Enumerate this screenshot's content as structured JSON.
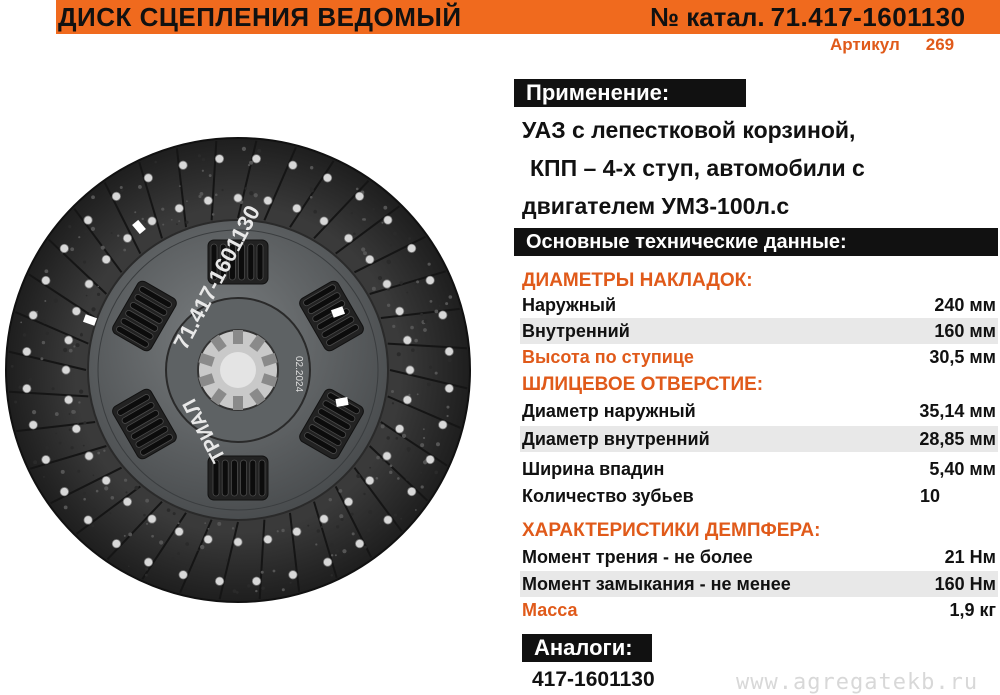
{
  "header": {
    "title": "ДИСК СЦЕПЛЕНИЯ ВЕДОМЫЙ",
    "catalog_label": "№ катал.",
    "catalog_number": "71.417-1601130",
    "article_label": "Артикул",
    "article_value": "269"
  },
  "disc_image": {
    "marking": "71.417-1601130",
    "brand": "ТРИАЛ",
    "small_code": "02.2024"
  },
  "application": {
    "heading": "Применение:",
    "lines": [
      "УАЗ с лепестковой корзиной,",
      "КПП – 4-х ступ, автомобили с",
      "двигателем УМЗ-100л.с"
    ]
  },
  "specs": {
    "heading": "Основные технические данные:",
    "linings_title": "ДИАМЕТРЫ НАКЛАДОК:",
    "linings": [
      {
        "label": "Наружный",
        "value": "240 мм"
      },
      {
        "label": "Внутренний",
        "value": "160 мм"
      },
      {
        "label": "Высота по ступице",
        "value": "30,5 мм"
      }
    ],
    "spline_title": "ШЛИЦЕВОЕ ОТВЕРСТИЕ:",
    "spline": [
      {
        "label": "Диаметр наружный",
        "value": "35,14 мм"
      },
      {
        "label": "Диаметр внутренний",
        "value": "28,85 мм"
      },
      {
        "label": "Ширина впадин",
        "value": "5,40 мм"
      },
      {
        "label": "Количество зубьев",
        "value": "10"
      }
    ],
    "damper_title": "ХАРАКТЕРИСТИКИ ДЕМПФЕРА:",
    "damper": [
      {
        "label": "Момент трения - не более",
        "value": "21 Нм"
      },
      {
        "label": "Момент замыкания - не менее",
        "value": "160 Нм"
      },
      {
        "label": "Масса",
        "value": "1,9 кг"
      }
    ]
  },
  "analogs": {
    "heading": "Аналоги:",
    "value": "417-1601130"
  },
  "watermark": "www.agregatekb.ru",
  "colors": {
    "accent": "#f06a1e",
    "accent_text": "#e05a1a",
    "heading_bg": "#111111"
  }
}
